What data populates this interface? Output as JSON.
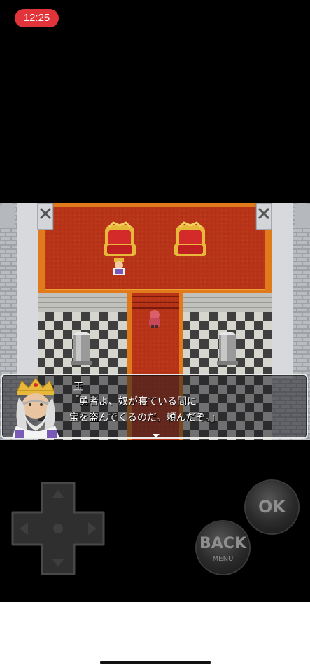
{
  "status_bar": {
    "time": "12:25",
    "accent": "#e0343a"
  },
  "dialog": {
    "speaker": "王",
    "line1": "「勇者よ、奴が寝ている間に",
    "line2": "宝を盗んでくるのだ。頼んだぞ。」",
    "portrait_icon": "king-portrait",
    "continue_icon": "triangle-down"
  },
  "controls": {
    "ok_label": "OK",
    "back_label": "BACK",
    "back_sub_label": "MENU",
    "dpad_icon": "dpad"
  },
  "colors": {
    "carpet": "#b83418",
    "carpet_border": "#e07a1a",
    "throne": "#d42a2a",
    "gold": "#e8b83a",
    "wall": "#c9cbce",
    "floor_dark": "#3f3f3f",
    "floor_light": "#d6d6cf"
  }
}
